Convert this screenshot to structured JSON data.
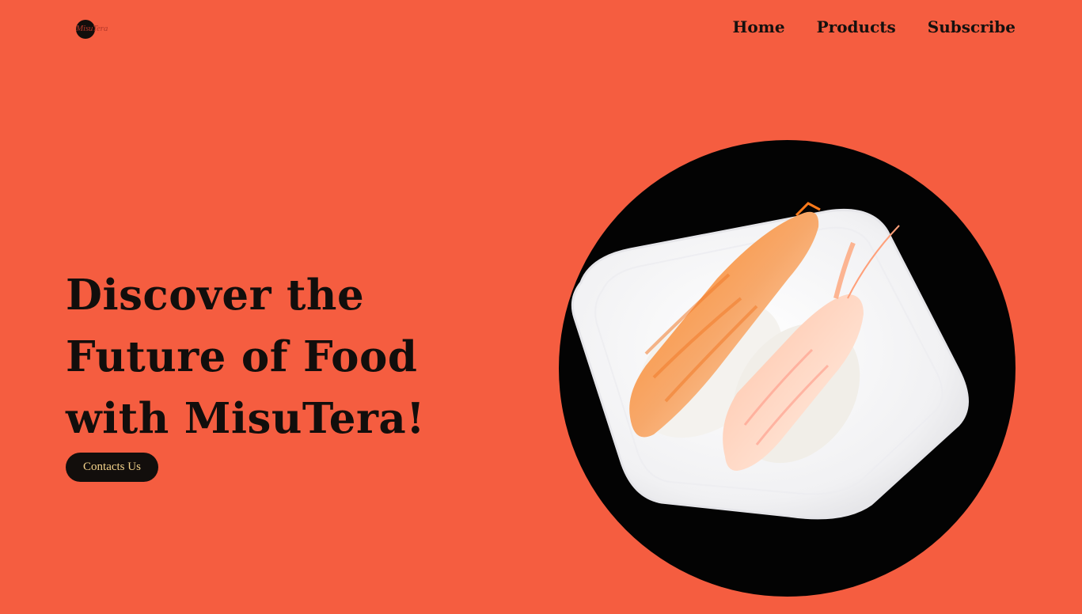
{
  "header": {
    "logo_text": "MisuTera",
    "nav": [
      {
        "label": "Home"
      },
      {
        "label": "Products"
      },
      {
        "label": "Subscribe"
      }
    ]
  },
  "hero": {
    "headline": "Discover the Future of Food with MisuTera!",
    "cta_label": "Contacts Us"
  },
  "colors": {
    "background": "#f55d40",
    "text": "#120e0c",
    "button_bg": "#120e0c",
    "button_text": "#f3d28a"
  },
  "icons": {
    "logo": "logo-icon",
    "hero_image": "shrimp-sushi-plate-image"
  }
}
